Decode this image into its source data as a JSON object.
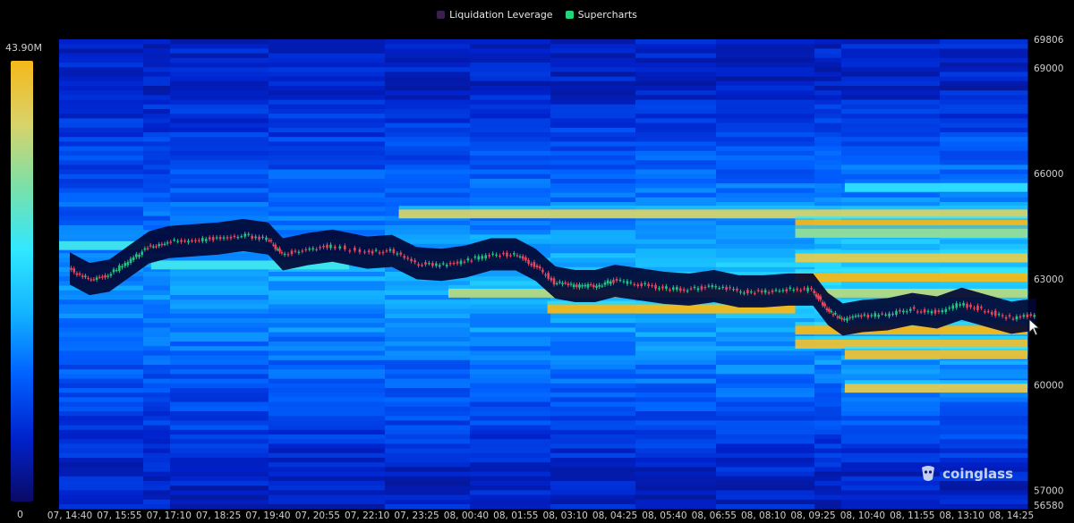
{
  "legend": [
    {
      "label": "Liquidation Leverage",
      "color": "#3a1f4f"
    },
    {
      "label": "Supercharts",
      "color": "#1fd67a"
    }
  ],
  "colorscale": {
    "max_label": "43.90M",
    "min_label": "0",
    "stops": [
      "#0a0a66",
      "#0022cc",
      "#0060ff",
      "#13b4ff",
      "#30e8ff",
      "#7be0a8",
      "#d9d36a",
      "#f5b81a"
    ]
  },
  "watermark": {
    "text": "coinglass",
    "icon": "coinglass-logo-icon"
  },
  "chart_data": {
    "type": "heatmap",
    "x_ticks": [
      "07, 14:40",
      "07, 15:55",
      "07, 17:10",
      "07, 18:25",
      "07, 19:40",
      "07, 20:55",
      "07, 22:10",
      "07, 23:25",
      "08, 00:40",
      "08, 01:55",
      "08, 03:10",
      "08, 04:25",
      "08, 05:40",
      "08, 06:55",
      "08, 08:10",
      "08, 09:25",
      "08, 10:40",
      "08, 11:55",
      "08, 13:10",
      "08, 14:25"
    ],
    "y_ticks": [
      69806,
      69000,
      66000,
      63000,
      60000,
      57000,
      56580
    ],
    "ylim": [
      56580,
      69806
    ],
    "colorbar_range": [
      0,
      43900000
    ],
    "liquidation_bands": [
      {
        "price": 64850,
        "start": 7,
        "end": 20,
        "level": 0.85
      },
      {
        "price": 64550,
        "start": 15,
        "end": 20,
        "level": 1.0
      },
      {
        "price": 64300,
        "start": 15,
        "end": 20,
        "level": 0.75
      },
      {
        "price": 63600,
        "start": 15,
        "end": 20,
        "level": 0.9
      },
      {
        "price": 63050,
        "start": 15,
        "end": 20,
        "level": 1.0
      },
      {
        "price": 62600,
        "start": 8,
        "end": 20,
        "level": 0.8
      },
      {
        "price": 62150,
        "start": 10,
        "end": 15,
        "level": 1.0
      },
      {
        "price": 61550,
        "start": 15,
        "end": 20,
        "level": 1.0
      },
      {
        "price": 61150,
        "start": 15,
        "end": 20,
        "level": 0.95
      },
      {
        "price": 60850,
        "start": 16,
        "end": 20,
        "level": 0.95
      },
      {
        "price": 59900,
        "start": 16,
        "end": 20,
        "level": 0.9
      },
      {
        "price": 65600,
        "start": 16,
        "end": 20,
        "level": 0.55
      },
      {
        "price": 63950,
        "start": 0,
        "end": 2,
        "level": 0.6
      },
      {
        "price": 63400,
        "start": 2,
        "end": 6,
        "level": 0.6
      }
    ],
    "price_path": [
      [
        0,
        63300
      ],
      [
        0.4,
        63000
      ],
      [
        0.8,
        63100
      ],
      [
        1.2,
        63500
      ],
      [
        1.6,
        63900
      ],
      [
        2.0,
        64050
      ],
      [
        2.5,
        64100
      ],
      [
        3.0,
        64150
      ],
      [
        3.5,
        64250
      ],
      [
        4.0,
        64150
      ],
      [
        4.3,
        63700
      ],
      [
        4.8,
        63850
      ],
      [
        5.3,
        63950
      ],
      [
        6.0,
        63750
      ],
      [
        6.5,
        63800
      ],
      [
        7.0,
        63450
      ],
      [
        7.5,
        63400
      ],
      [
        8.0,
        63500
      ],
      [
        8.5,
        63700
      ],
      [
        9.0,
        63700
      ],
      [
        9.4,
        63400
      ],
      [
        9.8,
        62900
      ],
      [
        10.2,
        62800
      ],
      [
        10.6,
        62800
      ],
      [
        11.0,
        62950
      ],
      [
        11.5,
        62850
      ],
      [
        12.0,
        62750
      ],
      [
        12.5,
        62700
      ],
      [
        13.0,
        62800
      ],
      [
        13.5,
        62650
      ],
      [
        14.0,
        62650
      ],
      [
        14.5,
        62700
      ],
      [
        15.0,
        62700
      ],
      [
        15.3,
        62150
      ],
      [
        15.6,
        61850
      ],
      [
        16.0,
        61950
      ],
      [
        16.5,
        62000
      ],
      [
        17.0,
        62150
      ],
      [
        17.5,
        62050
      ],
      [
        18.0,
        62300
      ],
      [
        18.5,
        62100
      ],
      [
        19.0,
        61900
      ],
      [
        19.5,
        62000
      ]
    ]
  }
}
